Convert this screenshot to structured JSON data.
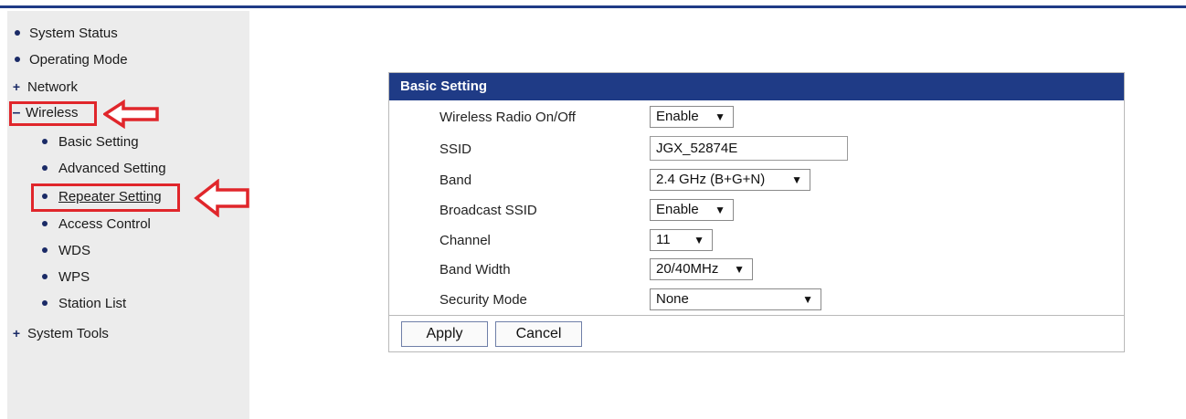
{
  "sidebar": {
    "items": [
      {
        "label": "System Status",
        "marker": "bullet"
      },
      {
        "label": "Operating Mode",
        "marker": "bullet"
      },
      {
        "label": "Network",
        "marker": "plus"
      },
      {
        "label": "Wireless",
        "marker": "minus"
      },
      {
        "label": "Basic Setting",
        "marker": "bullet"
      },
      {
        "label": "Advanced Setting",
        "marker": "bullet"
      },
      {
        "label": "Repeater Setting",
        "marker": "bullet"
      },
      {
        "label": "Access Control",
        "marker": "bullet"
      },
      {
        "label": "WDS",
        "marker": "bullet"
      },
      {
        "label": "WPS",
        "marker": "bullet"
      },
      {
        "label": "Station List",
        "marker": "bullet"
      },
      {
        "label": "System Tools",
        "marker": "plus"
      }
    ]
  },
  "panel": {
    "title": "Basic Setting",
    "fields": [
      {
        "label": "Wireless Radio On/Off",
        "value": "Enable"
      },
      {
        "label": "SSID",
        "value": "JGX_52874E"
      },
      {
        "label": "Band",
        "value": "2.4 GHz (B+G+N)"
      },
      {
        "label": "Broadcast SSID",
        "value": "Enable"
      },
      {
        "label": "Channel",
        "value": "11"
      },
      {
        "label": "Band Width",
        "value": "20/40MHz"
      },
      {
        "label": "Security Mode",
        "value": "None"
      }
    ],
    "apply_label": "Apply",
    "cancel_label": "Cancel"
  },
  "caret": "▼",
  "colors": {
    "header": "#1f3b86",
    "sidebar": "#ececec",
    "highlight": "#e0262b"
  }
}
